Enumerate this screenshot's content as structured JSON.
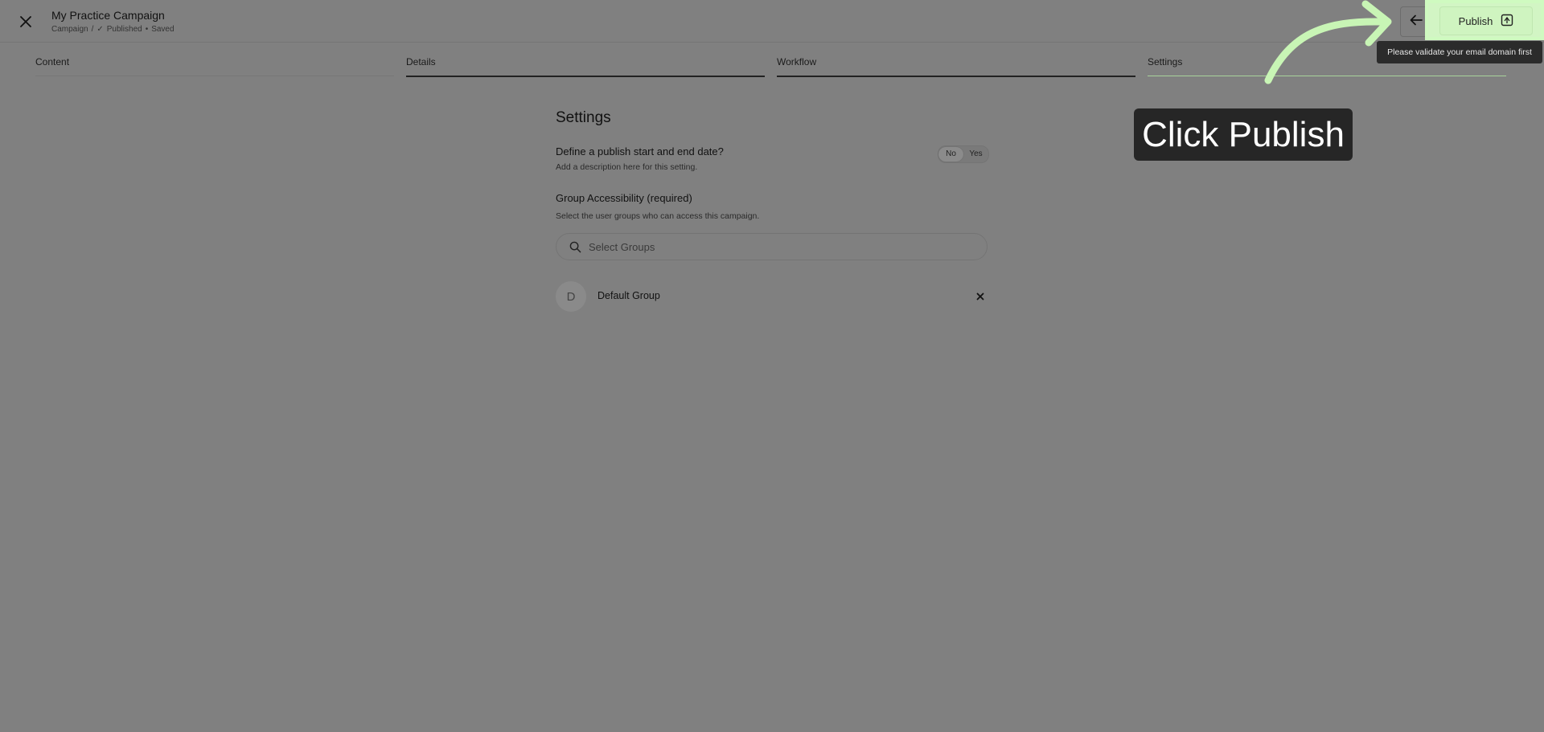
{
  "header": {
    "title": "My Practice Campaign",
    "breadcrumb": "Campaign",
    "breadcrumb_sep": "/",
    "status_check": "✓",
    "status": "Published",
    "dot": "•",
    "saved": "Saved",
    "publish_label": "Publish",
    "tooltip": "Please validate your email domain first"
  },
  "tabs": [
    {
      "label": "Content"
    },
    {
      "label": "Details"
    },
    {
      "label": "Workflow"
    },
    {
      "label": "Settings"
    }
  ],
  "settings": {
    "heading": "Settings",
    "dates_label": "Define a publish start and end date?",
    "dates_desc": "Add a description here for this setting.",
    "toggle_no": "No",
    "toggle_yes": "Yes",
    "toggle_selected": "No",
    "group_label": "Group Accessibility (required)",
    "group_desc": "Select the user groups who can access this campaign.",
    "search_placeholder": "Select Groups",
    "groups": [
      {
        "initial": "D",
        "name": "Default Group"
      }
    ]
  },
  "callout": {
    "text": "Click Publish"
  },
  "colors": {
    "overlay": "#808080",
    "highlight": "#cffac0",
    "callout_bg": "#262626"
  }
}
